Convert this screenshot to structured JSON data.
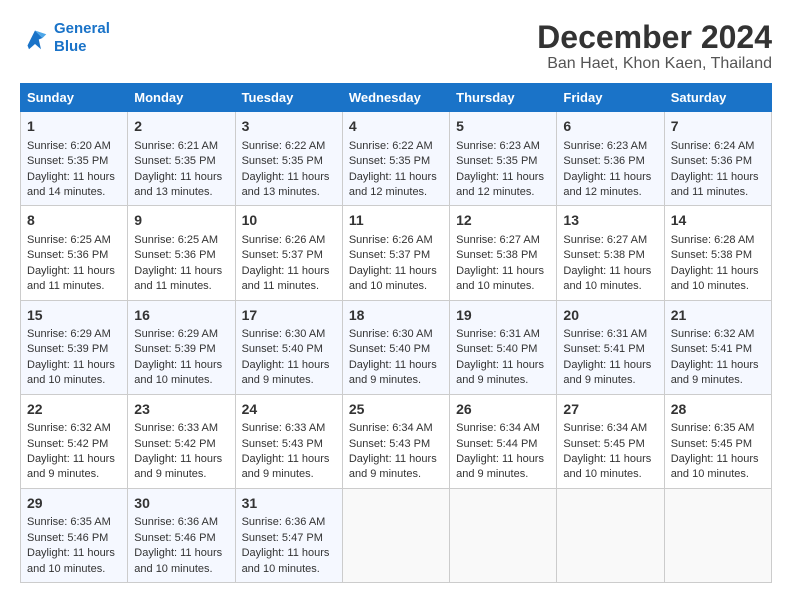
{
  "logo": {
    "line1": "General",
    "line2": "Blue"
  },
  "title": "December 2024",
  "subtitle": "Ban Haet, Khon Kaen, Thailand",
  "days_of_week": [
    "Sunday",
    "Monday",
    "Tuesday",
    "Wednesday",
    "Thursday",
    "Friday",
    "Saturday"
  ],
  "weeks": [
    [
      {
        "day": "1",
        "sunrise": "6:20 AM",
        "sunset": "5:35 PM",
        "daylight": "11 hours and 14 minutes."
      },
      {
        "day": "2",
        "sunrise": "6:21 AM",
        "sunset": "5:35 PM",
        "daylight": "11 hours and 13 minutes."
      },
      {
        "day": "3",
        "sunrise": "6:22 AM",
        "sunset": "5:35 PM",
        "daylight": "11 hours and 13 minutes."
      },
      {
        "day": "4",
        "sunrise": "6:22 AM",
        "sunset": "5:35 PM",
        "daylight": "11 hours and 12 minutes."
      },
      {
        "day": "5",
        "sunrise": "6:23 AM",
        "sunset": "5:35 PM",
        "daylight": "11 hours and 12 minutes."
      },
      {
        "day": "6",
        "sunrise": "6:23 AM",
        "sunset": "5:36 PM",
        "daylight": "11 hours and 12 minutes."
      },
      {
        "day": "7",
        "sunrise": "6:24 AM",
        "sunset": "5:36 PM",
        "daylight": "11 hours and 11 minutes."
      }
    ],
    [
      {
        "day": "8",
        "sunrise": "6:25 AM",
        "sunset": "5:36 PM",
        "daylight": "11 hours and 11 minutes."
      },
      {
        "day": "9",
        "sunrise": "6:25 AM",
        "sunset": "5:36 PM",
        "daylight": "11 hours and 11 minutes."
      },
      {
        "day": "10",
        "sunrise": "6:26 AM",
        "sunset": "5:37 PM",
        "daylight": "11 hours and 11 minutes."
      },
      {
        "day": "11",
        "sunrise": "6:26 AM",
        "sunset": "5:37 PM",
        "daylight": "11 hours and 10 minutes."
      },
      {
        "day": "12",
        "sunrise": "6:27 AM",
        "sunset": "5:38 PM",
        "daylight": "11 hours and 10 minutes."
      },
      {
        "day": "13",
        "sunrise": "6:27 AM",
        "sunset": "5:38 PM",
        "daylight": "11 hours and 10 minutes."
      },
      {
        "day": "14",
        "sunrise": "6:28 AM",
        "sunset": "5:38 PM",
        "daylight": "11 hours and 10 minutes."
      }
    ],
    [
      {
        "day": "15",
        "sunrise": "6:29 AM",
        "sunset": "5:39 PM",
        "daylight": "11 hours and 10 minutes."
      },
      {
        "day": "16",
        "sunrise": "6:29 AM",
        "sunset": "5:39 PM",
        "daylight": "11 hours and 10 minutes."
      },
      {
        "day": "17",
        "sunrise": "6:30 AM",
        "sunset": "5:40 PM",
        "daylight": "11 hours and 9 minutes."
      },
      {
        "day": "18",
        "sunrise": "6:30 AM",
        "sunset": "5:40 PM",
        "daylight": "11 hours and 9 minutes."
      },
      {
        "day": "19",
        "sunrise": "6:31 AM",
        "sunset": "5:40 PM",
        "daylight": "11 hours and 9 minutes."
      },
      {
        "day": "20",
        "sunrise": "6:31 AM",
        "sunset": "5:41 PM",
        "daylight": "11 hours and 9 minutes."
      },
      {
        "day": "21",
        "sunrise": "6:32 AM",
        "sunset": "5:41 PM",
        "daylight": "11 hours and 9 minutes."
      }
    ],
    [
      {
        "day": "22",
        "sunrise": "6:32 AM",
        "sunset": "5:42 PM",
        "daylight": "11 hours and 9 minutes."
      },
      {
        "day": "23",
        "sunrise": "6:33 AM",
        "sunset": "5:42 PM",
        "daylight": "11 hours and 9 minutes."
      },
      {
        "day": "24",
        "sunrise": "6:33 AM",
        "sunset": "5:43 PM",
        "daylight": "11 hours and 9 minutes."
      },
      {
        "day": "25",
        "sunrise": "6:34 AM",
        "sunset": "5:43 PM",
        "daylight": "11 hours and 9 minutes."
      },
      {
        "day": "26",
        "sunrise": "6:34 AM",
        "sunset": "5:44 PM",
        "daylight": "11 hours and 9 minutes."
      },
      {
        "day": "27",
        "sunrise": "6:34 AM",
        "sunset": "5:45 PM",
        "daylight": "11 hours and 10 minutes."
      },
      {
        "day": "28",
        "sunrise": "6:35 AM",
        "sunset": "5:45 PM",
        "daylight": "11 hours and 10 minutes."
      }
    ],
    [
      {
        "day": "29",
        "sunrise": "6:35 AM",
        "sunset": "5:46 PM",
        "daylight": "11 hours and 10 minutes."
      },
      {
        "day": "30",
        "sunrise": "6:36 AM",
        "sunset": "5:46 PM",
        "daylight": "11 hours and 10 minutes."
      },
      {
        "day": "31",
        "sunrise": "6:36 AM",
        "sunset": "5:47 PM",
        "daylight": "11 hours and 10 minutes."
      },
      null,
      null,
      null,
      null
    ]
  ]
}
